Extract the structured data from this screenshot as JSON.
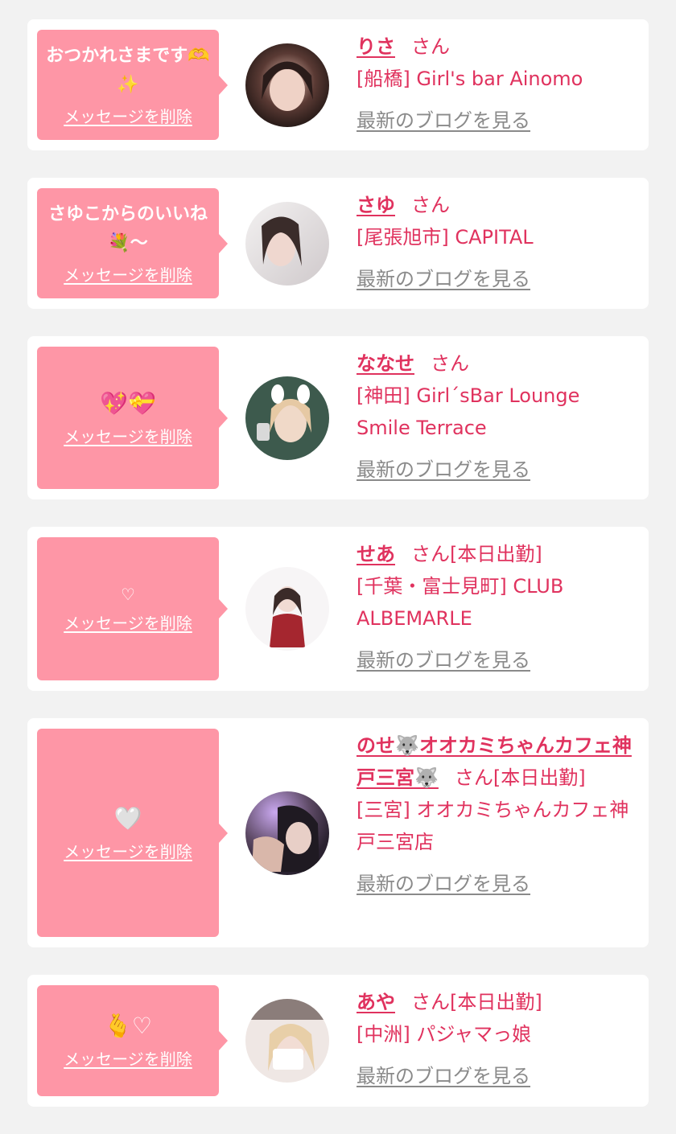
{
  "common": {
    "delete_label": "メッセージを削除",
    "blog_label": "最新のブログを見る",
    "honorific": "さん"
  },
  "colors": {
    "page_background": "#f2f2f2",
    "card_background": "#ffffff",
    "bubble_pink": "#fe96a6",
    "name_text": "#e0325e",
    "blog_link": "#8a8a8a"
  },
  "messages": [
    {
      "message": "おつかれさまです🫶✨",
      "name": "りさ",
      "honorific_suffix": "さん",
      "shop": "[船橋] Girl's bar Ainomo"
    },
    {
      "message": "さゆこからのいいね💐〜",
      "name": "さゆ",
      "honorific_suffix": "さん",
      "shop": "[尾張旭市] CAPITAL"
    },
    {
      "message": "💖💝",
      "name": "ななせ",
      "honorific_suffix": "さん",
      "shop": "[神田] Girl´sBar Lounge Smile Terrace"
    },
    {
      "message": "♡",
      "name": "せあ",
      "honorific_suffix": "さん[本日出勤]",
      "shop": "[千葉・富士見町] CLUB ALBEMARLE"
    },
    {
      "message": "🤍",
      "name": "のせ🐺オオカミちゃんカフェ神戸三宮🐺",
      "honorific_suffix": "さん[本日出勤]",
      "shop": "[三宮] オオカミちゃんカフェ神戸三宮店"
    },
    {
      "message": "🫰♡",
      "name": "あや",
      "honorific_suffix": "さん[本日出勤]",
      "shop": "[中洲] パジャマっ娘"
    }
  ]
}
